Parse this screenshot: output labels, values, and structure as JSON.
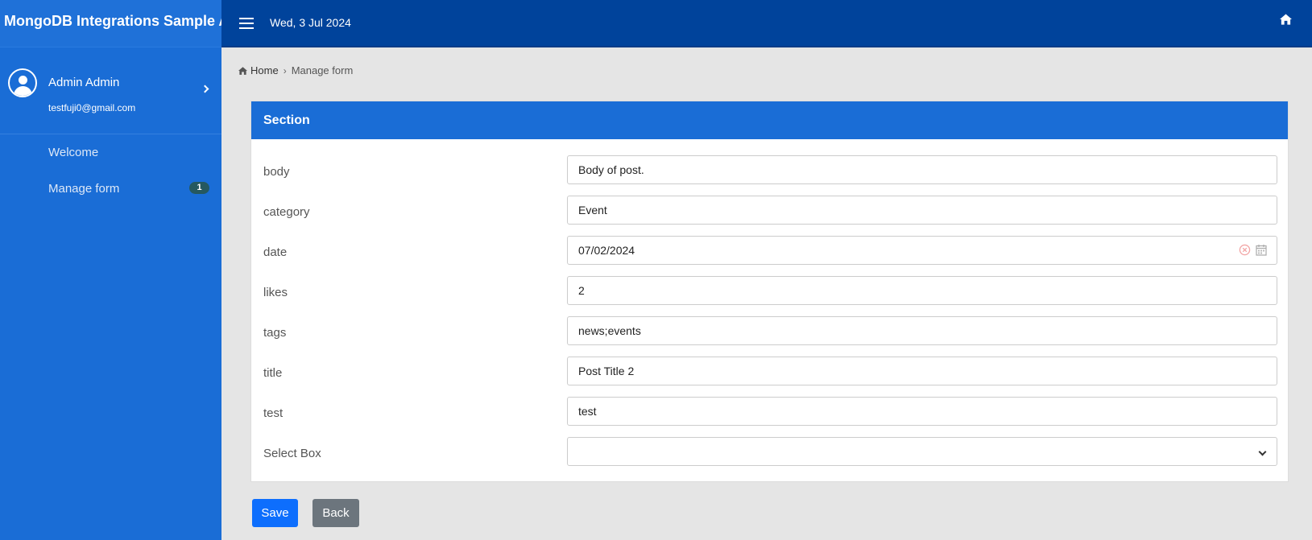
{
  "app": {
    "title": "MongoDB Integrations Sample A"
  },
  "header": {
    "date": "Wed, 3 Jul 2024"
  },
  "user": {
    "name": "Admin Admin",
    "email": "testfuji0@gmail.com"
  },
  "sidebar": {
    "items": [
      {
        "label": "Welcome"
      },
      {
        "label": "Manage form",
        "badge": "1"
      }
    ]
  },
  "breadcrumb": {
    "home": "Home",
    "current": "Manage form"
  },
  "section": {
    "title": "Section"
  },
  "form": {
    "fields": [
      {
        "label": "body",
        "value": "Body of post."
      },
      {
        "label": "category",
        "value": "Event"
      },
      {
        "label": "date",
        "value": "07/02/2024"
      },
      {
        "label": "likes",
        "value": "2"
      },
      {
        "label": "tags",
        "value": "news;events"
      },
      {
        "label": "title",
        "value": "Post Title 2"
      },
      {
        "label": "test",
        "value": "test"
      },
      {
        "label": "Select Box",
        "value": ""
      }
    ]
  },
  "buttons": {
    "save": "Save",
    "back": "Back"
  },
  "icons": {
    "menu": "hamburger-icon",
    "home": "home-icon",
    "clear": "clear-circle-icon",
    "calendar": "calendar-icon",
    "avatar": "user-avatar-icon"
  },
  "colors": {
    "sidebar": "#1a6dd6",
    "topbar": "#00439b",
    "save": "#0d6efd",
    "back": "#6c757d",
    "badge": "#25585f"
  }
}
